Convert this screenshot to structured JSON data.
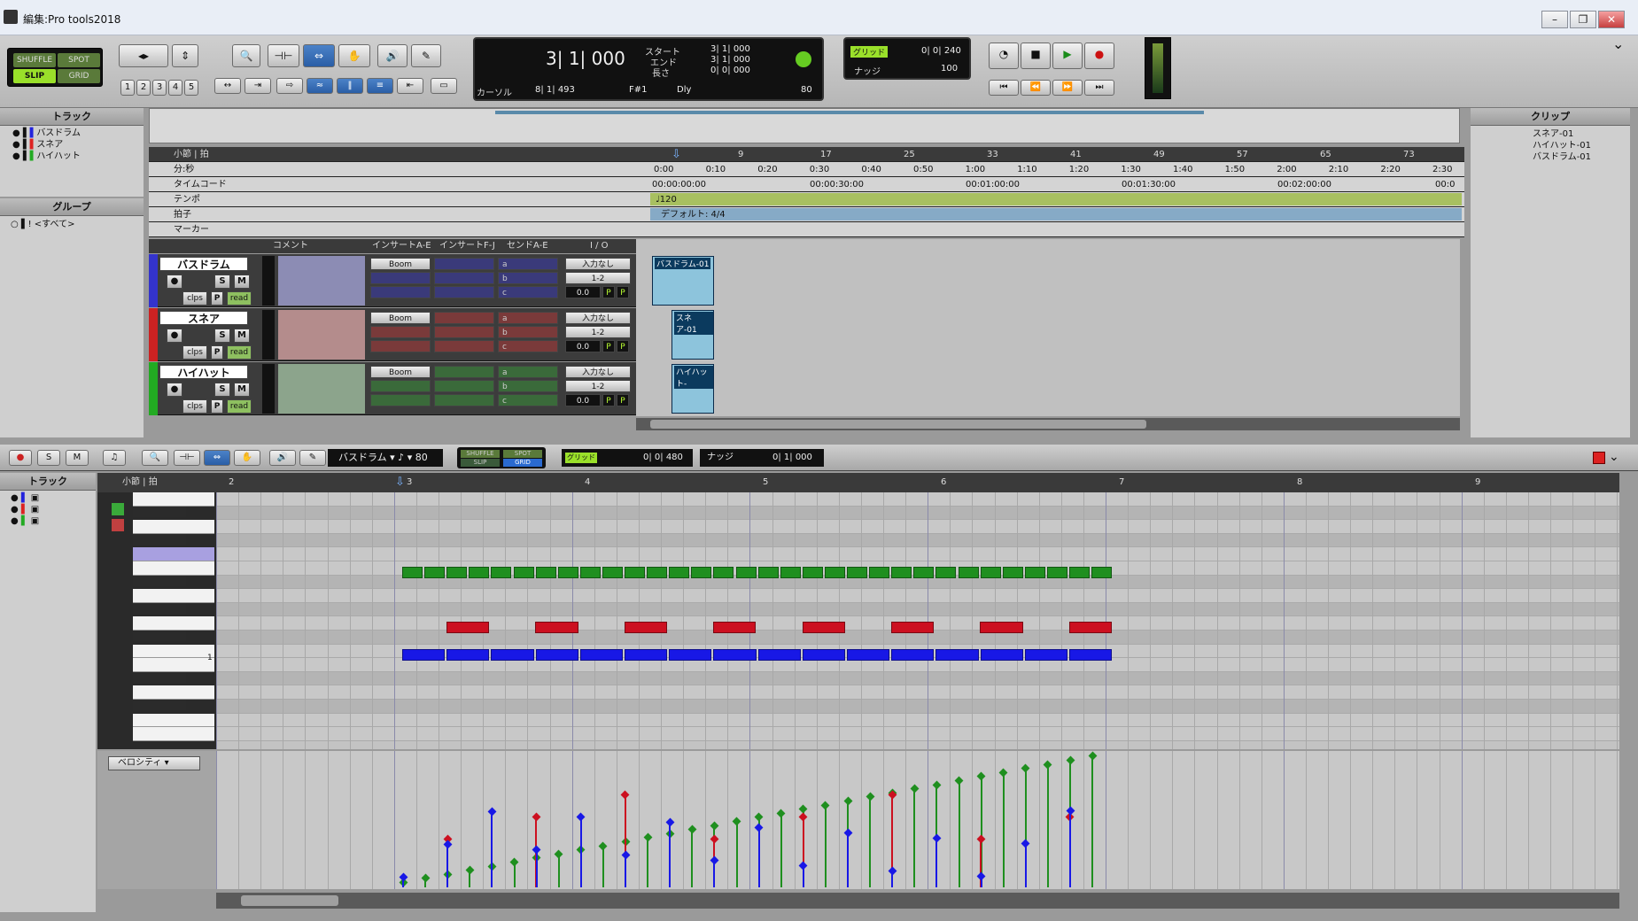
{
  "window": {
    "title": "編集:Pro tools2018",
    "min": "–",
    "max": "❐",
    "close": "✕"
  },
  "mode": {
    "shuffle": "SHUFFLE",
    "spot": "SPOT",
    "slip": "SLIP",
    "grid": "GRID"
  },
  "zoom_presets": [
    "1",
    "2",
    "3",
    "4",
    "5"
  ],
  "counter": {
    "main": "3| 1| 000",
    "start_label": "スタート",
    "end_label": "エンド",
    "length_label": "長さ",
    "start": "3| 1| 000",
    "end": "3| 1| 000",
    "length": "0| 0| 000",
    "cursor_label": "カーソル",
    "cursor": "8| 1| 493",
    "pitch": "F#1",
    "dly": "Dly",
    "tempo_value": "80"
  },
  "grid_nudge": {
    "grid_label": "グリッド",
    "grid_value": "0| 0| 240",
    "nudge_label": "ナッジ",
    "nudge_value": "100"
  },
  "tracks_panel": {
    "title": "トラック",
    "items": [
      {
        "name": "バスドラム",
        "color": "#2222dd"
      },
      {
        "name": "スネア",
        "color": "#dd2222"
      },
      {
        "name": "ハイハット",
        "color": "#22aa22"
      }
    ]
  },
  "groups_panel": {
    "title": "グループ",
    "item": "<すべて>"
  },
  "clips_panel": {
    "title": "クリップ",
    "items": [
      "スネア-01",
      "ハイハット-01",
      "バスドラム-01"
    ]
  },
  "rulers": {
    "bars_label": "小節 | 拍",
    "minsec_label": "分:秒",
    "timecode_label": "タイムコード",
    "tempo_label": "テンポ",
    "meter_label": "拍子",
    "marker_label": "マーカー",
    "bar_ticks": [
      "9",
      "17",
      "25",
      "33",
      "41",
      "49",
      "57",
      "65",
      "73"
    ],
    "min_ticks": [
      "0:00",
      "0:10",
      "0:20",
      "0:30",
      "0:40",
      "0:50",
      "1:00",
      "1:10",
      "1:20",
      "1:30",
      "1:40",
      "1:50",
      "2:00",
      "2:10",
      "2:20",
      "2:30"
    ],
    "tc_ticks": [
      "00:00:00:00",
      "00:00:30:00",
      "00:01:00:00",
      "00:01:30:00",
      "00:02:00:00",
      "00:0"
    ],
    "tempo_value": "♩120",
    "meter_value": "デフォルト: 4/4"
  },
  "columns": {
    "comment": "コメント",
    "inserts_ae": "インサートA-E",
    "inserts_fj": "インサートF-J",
    "sends_ae": "センドA-E",
    "io": "I / O"
  },
  "track_rows": [
    {
      "name": "バスドラム",
      "plugin": "Boom",
      "sends": [
        "a",
        "b",
        "c"
      ],
      "input": "入力なし",
      "output": "1-2",
      "vol": "0.0",
      "clip": "バスドラム-01",
      "color": "#3333cc",
      "comment_bg": "#8c8cb4",
      "ins_bg": "#3a3a7a"
    },
    {
      "name": "スネア",
      "plugin": "Boom",
      "sends": [
        "a",
        "b",
        "c"
      ],
      "input": "入力なし",
      "output": "1-2",
      "vol": "0.0",
      "clip": "スネア-01",
      "color": "#cc2222",
      "comment_bg": "#b48c8c",
      "ins_bg": "#7a3a3a"
    },
    {
      "name": "ハイハット",
      "plugin": "Boom",
      "sends": [
        "a",
        "b",
        "c"
      ],
      "input": "入力なし",
      "output": "1-2",
      "vol": "0.0",
      "clip": "ハイハット-",
      "color": "#22aa22",
      "comment_bg": "#8ca48c",
      "ins_bg": "#3a6a3a"
    }
  ],
  "track_btns": {
    "s": "S",
    "m": "M",
    "clips": "clps",
    "p": "P",
    "read": "read"
  },
  "midi_editor": {
    "track_title": "トラック",
    "bars_label": "小節 | 拍",
    "instrument": "バスドラム",
    "tempo_value": "80",
    "grid_label": "グリッド",
    "grid_value": "0| 0| 480",
    "nudge_label": "ナッジ",
    "nudge_value": "0| 1| 000",
    "bar_ticks": [
      "2",
      "3",
      "4",
      "5",
      "6",
      "7",
      "8",
      "9"
    ],
    "key_label": "1",
    "velocity_label": "ベロシティ",
    "s": "S",
    "m": "M"
  },
  "notes": {
    "hihat": {
      "color": "#1f8f1f",
      "count": 32
    },
    "snare": {
      "color": "#cc1020",
      "count": 8
    },
    "kick": {
      "color": "#1818e6",
      "count": 16
    }
  }
}
